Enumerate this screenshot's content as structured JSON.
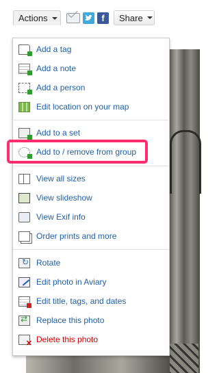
{
  "toolbar": {
    "actions_label": "Actions",
    "share_label": "Share",
    "facebook_glyph": "f",
    "icons": [
      "email-icon",
      "twitter-icon",
      "facebook-icon"
    ]
  },
  "menu": {
    "group1": [
      {
        "label": "Add a tag",
        "icon": "add-tag-icon"
      },
      {
        "label": "Add a note",
        "icon": "add-note-icon"
      },
      {
        "label": "Add a person",
        "icon": "add-person-icon"
      },
      {
        "label": "Edit location on your map",
        "icon": "map-location-icon"
      }
    ],
    "group2": [
      {
        "label": "Add to a set",
        "icon": "add-to-set-icon"
      },
      {
        "label": "Add to / remove from group",
        "icon": "group-icon",
        "highlighted": true
      }
    ],
    "group3": [
      {
        "label": "View all sizes",
        "icon": "sizes-icon"
      },
      {
        "label": "View slideshow",
        "icon": "slideshow-icon"
      },
      {
        "label": "View Exif info",
        "icon": "camera-icon"
      },
      {
        "label": "Order prints and more",
        "icon": "prints-icon"
      }
    ],
    "group4": [
      {
        "label": "Rotate",
        "icon": "rotate-icon"
      },
      {
        "label": "Edit photo in Aviary",
        "icon": "edit-photo-icon"
      },
      {
        "label": "Edit title, tags, and dates",
        "icon": "edit-title-icon"
      },
      {
        "label": "Replace this photo",
        "icon": "replace-icon"
      },
      {
        "label": "Delete this photo",
        "icon": "delete-icon"
      }
    ]
  },
  "colors": {
    "link": "#1f5faa",
    "delete": "#d20000",
    "highlight": "#ff2d6e"
  }
}
